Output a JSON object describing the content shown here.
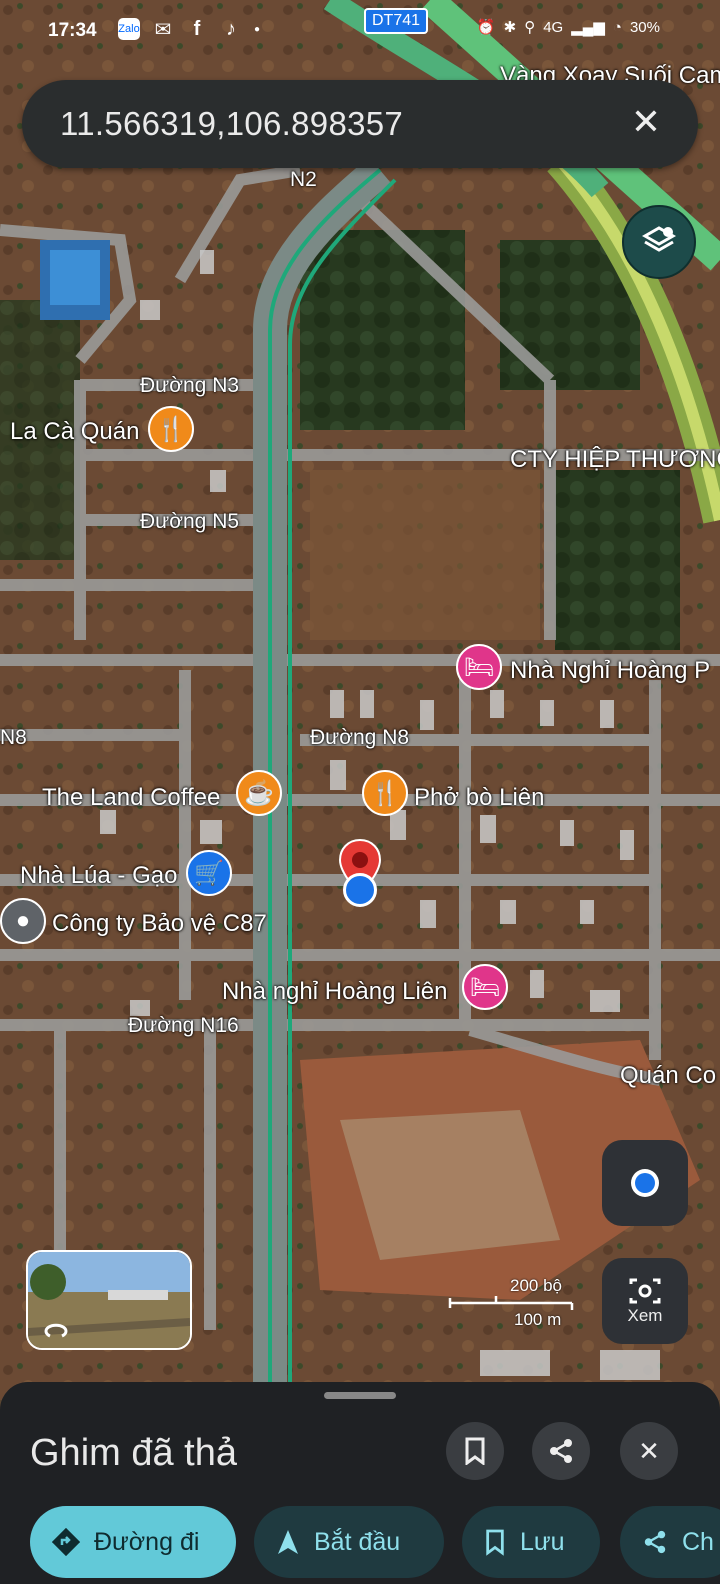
{
  "status": {
    "time": "17:34",
    "apps": [
      "Zalo",
      "Messenger",
      "Facebook",
      "TikTok"
    ],
    "network": "4G",
    "battery": "30%"
  },
  "search": {
    "query": "11.566319,106.898357"
  },
  "map": {
    "route_badge": "DT741",
    "labels": {
      "vuon": "Vàng Xoay Suối Cam",
      "n2": "N2",
      "n3": "Đường N3",
      "la_ca": "La Cà Quán",
      "cty": "CTY HIỆP THƯƠNG",
      "n5": "Đường N5",
      "nha_nghi_hp": "Nhà Nghỉ Hoàng P",
      "n8": "Đường N8",
      "n8_left": "N8",
      "land_coffee": "The Land Coffee",
      "pho": "Phở bò Liên",
      "nha_lua": "Nhà Lúa - Gạo",
      "cong_ty": "Công ty Bảo vệ C87",
      "nha_nghi_hl": "Nhà nghỉ Hoàng Liên",
      "n16": "Đường N16",
      "quan_co": "Quán Co"
    },
    "scale": {
      "feet": "200 bộ",
      "meters": "100 m"
    },
    "view_label": "Xem"
  },
  "sheet": {
    "title": "Ghim đã thả",
    "chips": {
      "directions": "Đường đi",
      "start": "Bắt đầu",
      "save": "Lưu",
      "share": "Ch"
    }
  }
}
